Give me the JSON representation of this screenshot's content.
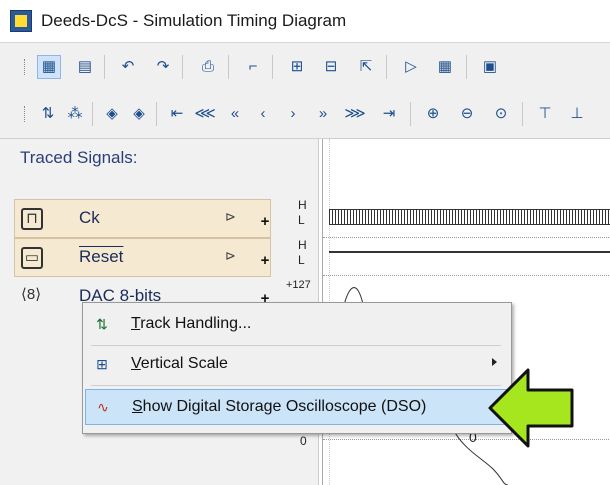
{
  "window": {
    "title": "Deeds-DcS  -  Simulation Timing Diagram"
  },
  "toolbar1": {
    "icons": [
      "grid-select-icon",
      "page-icon",
      "undo-icon",
      "redo-icon",
      "print-icon",
      "step-icon",
      "zoom-fit-icon",
      "signal-edit-icon",
      "cursor-select-icon",
      "play-icon",
      "stop-icon",
      "panel-icon"
    ]
  },
  "toolbar2": {
    "icons": [
      "signal-pick-icon",
      "signal-multi-icon",
      "move-left-icon",
      "move-right-icon",
      "first-icon",
      "fast-back-icon",
      "back-icon",
      "step-back-icon",
      "step-forward-icon",
      "forward-icon",
      "fast-forward-icon",
      "last-icon",
      "zoom-in-icon",
      "zoom-out-icon",
      "zoom-reset-icon",
      "split-icon",
      "merge-icon"
    ]
  },
  "traced": {
    "title": "Traced Signals:",
    "signals": [
      {
        "name": "Ck",
        "high": "H",
        "low": "L"
      },
      {
        "name": "Reset",
        "high": "H",
        "low": "L"
      },
      {
        "name": "DAC 8-bits",
        "max": "+127",
        "zero": "0"
      }
    ]
  },
  "wave": {
    "zero_label": "0"
  },
  "context_menu": {
    "items": [
      {
        "label": "Track Handling...",
        "accel": "T",
        "rest": "rack Handling..."
      },
      {
        "label": "Vertical Scale",
        "accel": "V",
        "rest": "ertical Scale"
      },
      {
        "label": "Show Digital Storage Oscilloscope (DSO)",
        "accel": "S",
        "rest": "how Digital Storage Oscilloscope (DSO)"
      }
    ]
  },
  "colors": {
    "accent_arrow": "#a6e61e",
    "menu_highlight": "#cce4f7"
  }
}
